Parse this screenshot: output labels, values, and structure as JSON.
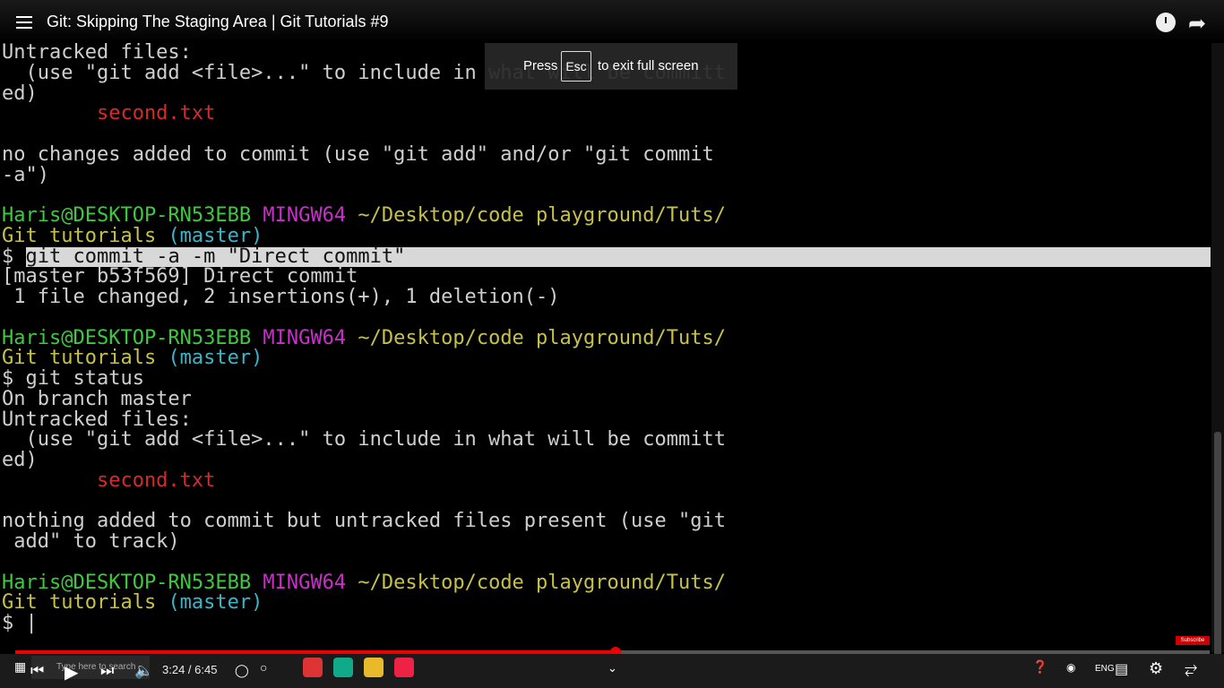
{
  "window": {
    "title": "Git: Skipping The Staging Area | Git Tutorials #9"
  },
  "toast": {
    "press": "Press",
    "key": "Esc",
    "message": "to exit full screen"
  },
  "terminal": {
    "lines": [
      {
        "segments": [
          {
            "text": "Untracked files:",
            "color": "gray"
          }
        ]
      },
      {
        "segments": [
          {
            "text": "  (use \"git add <file>...\" to include in what will be committ",
            "color": "gray"
          }
        ]
      },
      {
        "segments": [
          {
            "text": "ed)",
            "color": "gray"
          }
        ]
      },
      {
        "segments": [
          {
            "text": "        second.txt",
            "color": "red"
          }
        ]
      },
      {
        "segments": [
          {
            "text": "",
            "color": "gray"
          }
        ]
      },
      {
        "segments": [
          {
            "text": "no changes added to commit (use \"git add\" and/or \"git commit",
            "color": "gray"
          }
        ]
      },
      {
        "segments": [
          {
            "text": "-a\")",
            "color": "gray"
          }
        ]
      },
      {
        "segments": [
          {
            "text": "",
            "color": "gray"
          }
        ]
      },
      {
        "segments": [
          {
            "text": "Haris@DESKTOP-RN53EBB ",
            "color": "green"
          },
          {
            "text": "MINGW64 ",
            "color": "magenta"
          },
          {
            "text": "~/Desktop/code playground/Tuts/",
            "color": "yellow"
          }
        ]
      },
      {
        "segments": [
          {
            "text": "Git tutorials ",
            "color": "yellow"
          },
          {
            "text": "(master)",
            "color": "cyan"
          }
        ]
      },
      {
        "segments": [
          {
            "text": "$ ",
            "color": "gray"
          },
          {
            "text": "git commit -a -m \"Direct commit\"",
            "color": "hl"
          }
        ]
      },
      {
        "segments": [
          {
            "text": "[master b53f569] Direct commit",
            "color": "gray"
          }
        ]
      },
      {
        "segments": [
          {
            "text": " 1 file changed, 2 insertions(+), 1 deletion(-)",
            "color": "gray"
          }
        ]
      },
      {
        "segments": [
          {
            "text": "",
            "color": "gray"
          }
        ]
      },
      {
        "segments": [
          {
            "text": "Haris@DESKTOP-RN53EBB ",
            "color": "green"
          },
          {
            "text": "MINGW64 ",
            "color": "magenta"
          },
          {
            "text": "~/Desktop/code playground/Tuts/",
            "color": "yellow"
          }
        ]
      },
      {
        "segments": [
          {
            "text": "Git tutorials ",
            "color": "yellow"
          },
          {
            "text": "(master)",
            "color": "cyan"
          }
        ]
      },
      {
        "segments": [
          {
            "text": "$ git status",
            "color": "gray"
          }
        ]
      },
      {
        "segments": [
          {
            "text": "On branch master",
            "color": "gray"
          }
        ]
      },
      {
        "segments": [
          {
            "text": "Untracked files:",
            "color": "gray"
          }
        ]
      },
      {
        "segments": [
          {
            "text": "  (use \"git add <file>...\" to include in what will be committ",
            "color": "gray"
          }
        ]
      },
      {
        "segments": [
          {
            "text": "ed)",
            "color": "gray"
          }
        ]
      },
      {
        "segments": [
          {
            "text": "        second.txt",
            "color": "red"
          }
        ]
      },
      {
        "segments": [
          {
            "text": "",
            "color": "gray"
          }
        ]
      },
      {
        "segments": [
          {
            "text": "nothing added to commit but untracked files present (use \"git",
            "color": "gray"
          }
        ]
      },
      {
        "segments": [
          {
            "text": " add\" to track)",
            "color": "gray"
          }
        ]
      },
      {
        "segments": [
          {
            "text": "",
            "color": "gray"
          }
        ]
      },
      {
        "segments": [
          {
            "text": "Haris@DESKTOP-RN53EBB ",
            "color": "green"
          },
          {
            "text": "MINGW64 ",
            "color": "magenta"
          },
          {
            "text": "~/Desktop/code playground/Tuts/",
            "color": "yellow"
          }
        ]
      },
      {
        "segments": [
          {
            "text": "Git tutorials ",
            "color": "yellow"
          },
          {
            "text": "(master)",
            "color": "cyan"
          }
        ]
      },
      {
        "segments": [
          {
            "text": "$ |",
            "color": "gray"
          }
        ]
      }
    ]
  },
  "player": {
    "progress_fraction": 0.503,
    "time_current": "3:24",
    "time_separator": " / ",
    "time_total": "6:45",
    "subscribe": "Subscribe"
  },
  "taskbar": {
    "search_placeholder": "Type here to search",
    "lang": "ENG"
  }
}
